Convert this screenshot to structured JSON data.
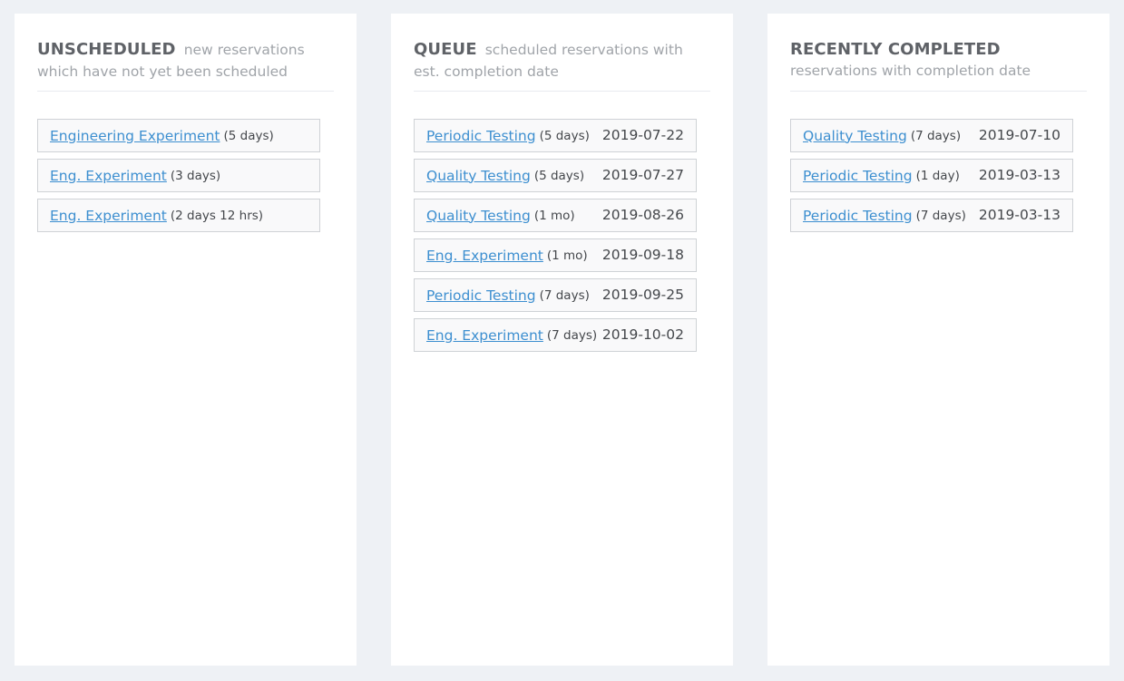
{
  "columns": [
    {
      "title": "UNSCHEDULED",
      "subtitle": "new reservations which have not yet been scheduled",
      "items": [
        {
          "name": "Engineering Experiment",
          "duration": "(5 days)",
          "date": ""
        },
        {
          "name": "Eng. Experiment",
          "duration": "(3 days)",
          "date": ""
        },
        {
          "name": "Eng. Experiment",
          "duration": "(2 days 12 hrs)",
          "date": ""
        }
      ]
    },
    {
      "title": "QUEUE",
      "subtitle": "scheduled reservations with est. completion date",
      "items": [
        {
          "name": "Periodic Testing",
          "duration": "(5 days)",
          "date": "2019-07-22"
        },
        {
          "name": "Quality Testing",
          "duration": "(5 days)",
          "date": "2019-07-27"
        },
        {
          "name": "Quality Testing",
          "duration": "(1 mo)",
          "date": "2019-08-26"
        },
        {
          "name": "Eng. Experiment",
          "duration": "(1 mo)",
          "date": "2019-09-18"
        },
        {
          "name": "Periodic Testing",
          "duration": "(7 days)",
          "date": "2019-09-25"
        },
        {
          "name": "Eng. Experiment",
          "duration": "(7 days)",
          "date": "2019-10-02"
        }
      ]
    },
    {
      "title": "RECENTLY COMPLETED",
      "subtitle": "reservations with completion date",
      "items": [
        {
          "name": "Quality Testing",
          "duration": "(7 days)",
          "date": "2019-07-10"
        },
        {
          "name": "Periodic Testing",
          "duration": "(1 day)",
          "date": "2019-03-13"
        },
        {
          "name": "Periodic Testing",
          "duration": "(7 days)",
          "date": "2019-03-13"
        }
      ]
    }
  ]
}
